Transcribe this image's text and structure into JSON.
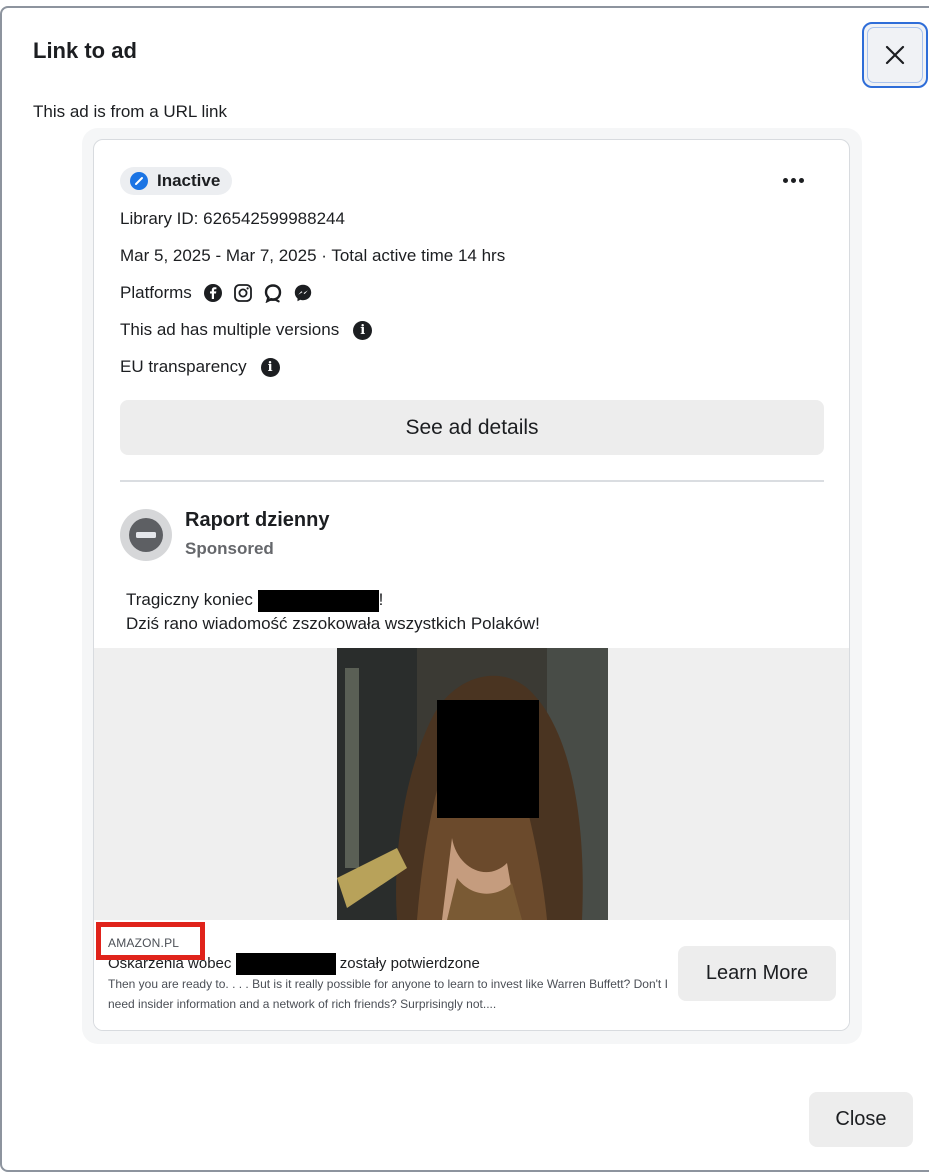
{
  "dialog": {
    "title": "Link to ad",
    "subtitle": "This ad is from a URL link",
    "close_button": "Close"
  },
  "ad": {
    "status": "Inactive",
    "library_id": "Library ID: 626542599988244",
    "dates": "Mar 5, 2025 - Mar 7, 2025 · Total active time 14 hrs",
    "platforms_label": "Platforms",
    "platforms": [
      "facebook-icon",
      "instagram-icon",
      "audience-network-icon",
      "messenger-icon"
    ],
    "versions_note": "This ad has multiple versions",
    "eu_label": "EU transparency",
    "details_button": "See ad details"
  },
  "post": {
    "page_name": "Raport dzienny",
    "sponsored": "Sponsored",
    "text_line1_prefix": "Tragiczny koniec",
    "text_line1_suffix": "!",
    "text_line2": "Dziś rano wiadomość zszokowała wszystkich Polaków!"
  },
  "link": {
    "domain": "AMAZON.PL",
    "title_prefix": "Oskarżenia wobec",
    "title_suffix": "zostały potwierdzone",
    "description": "Then you are ready to. . . . But is it really possible for anyone to learn to invest like Warren Buffett? Don't I need insider information and a network of rich friends? Surprisingly not....",
    "cta": "Learn More"
  },
  "colors": {
    "accent": "#1b74e4",
    "highlight_box": "#e0231b",
    "button_bg": "#ededed"
  }
}
